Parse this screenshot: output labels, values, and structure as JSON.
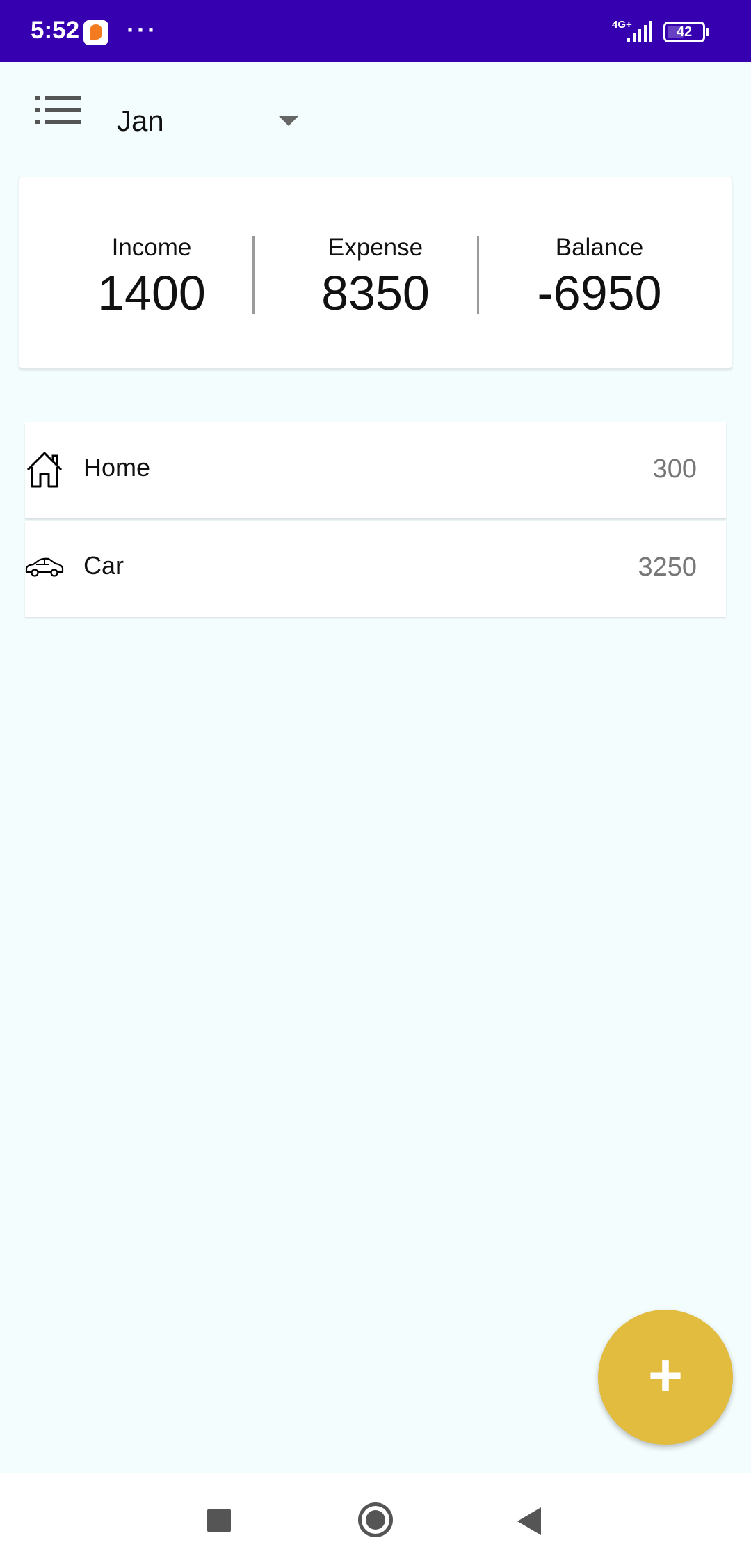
{
  "status_bar": {
    "time": "5:52",
    "notification_icon": "app-notification-icon",
    "more_dots": "···",
    "network": "4G+",
    "battery": "42",
    "background_color": "#3600b1"
  },
  "header": {
    "menu_icon": "list-icon",
    "month": "Jan"
  },
  "summary": {
    "income_label": "Income",
    "income_value": "1400",
    "expense_label": "Expense",
    "expense_value": "8350",
    "balance_label": "Balance",
    "balance_value": "-6950"
  },
  "categories": [
    {
      "icon": "home-icon",
      "label": "Home",
      "amount": "300"
    },
    {
      "icon": "car-icon",
      "label": "Car",
      "amount": "3250"
    }
  ],
  "fab": {
    "label": "+",
    "icon": "add-icon",
    "color": "#e2bc3f"
  },
  "nav": {
    "recents_icon": "recents-icon",
    "home_icon": "home-button-icon",
    "back_icon": "back-icon"
  }
}
